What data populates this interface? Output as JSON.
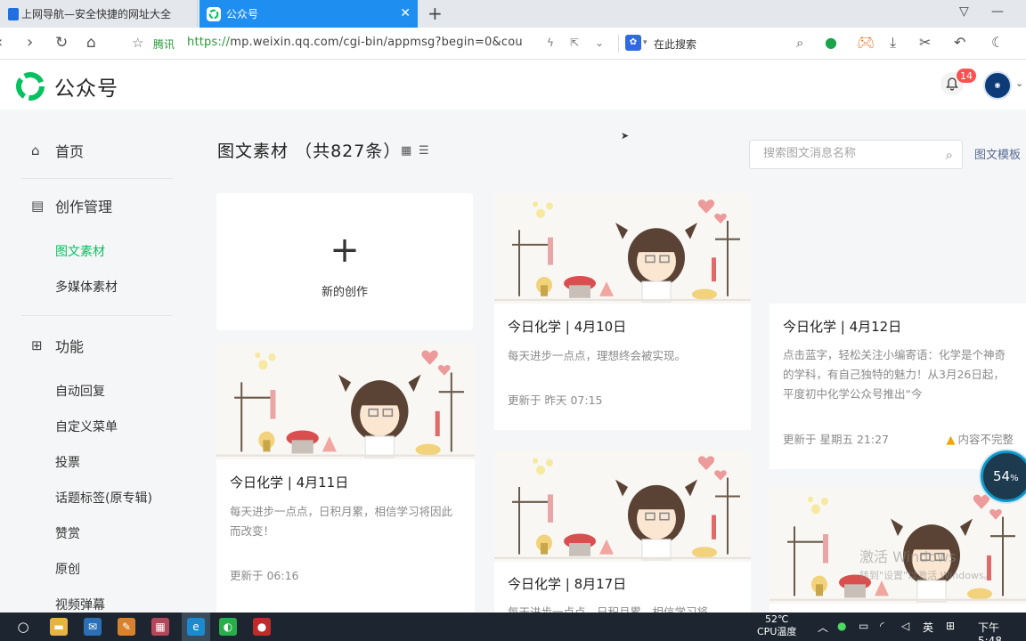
{
  "browser": {
    "tabs": [
      {
        "title": "上网导航—安全快捷的网址大全",
        "active": false
      },
      {
        "title": "公众号",
        "active": true
      }
    ],
    "new_tab": "+",
    "site_label": "腾讯",
    "url_scheme": "https://",
    "url_rest": "mp.weixin.qq.com/cgi-bin/appmsg?begin=0&cou",
    "search_label": "在此搜索"
  },
  "header": {
    "title": "公众号",
    "notification_count": "14",
    "brand_color": "#07c160"
  },
  "sidebar": {
    "home": "首页",
    "creation": "创作管理",
    "creation_items": [
      {
        "label": "图文素材",
        "active": true
      },
      {
        "label": "多媒体素材",
        "active": false
      }
    ],
    "functions": "功能",
    "function_items": [
      "自动回复",
      "自定义菜单",
      "投票",
      "话题标签(原专辑)",
      "赞赏",
      "原创",
      "视频弹幕"
    ]
  },
  "main": {
    "title": "图文素材",
    "count": "（共827条）",
    "search_placeholder": "搜索图文消息名称",
    "template_link": "图文模板",
    "new_creation": "新的创作",
    "cards": [
      {
        "title": "今日化学 | 4月11日",
        "desc": "每天进步一点点，日积月累，相信学习将因此而改变！",
        "time": "更新于 06:16"
      },
      {
        "title": "今日化学 | 4月10日",
        "desc": "每天进步一点点，理想终会被实现。",
        "time": "更新于 昨天 07:15"
      },
      {
        "title": "今日化学 | 8月17日",
        "desc": "每天进步一点点，日积月累，相信学习将",
        "time": ""
      },
      {
        "title": "今日化学 | 4月12日",
        "desc": "点击蓝字，轻松关注小编寄语：化学是个神奇的学科，有自己独特的魅力！从3月26日起，平度初中化学公众号推出“今",
        "time": "更新于 星期五 21:27",
        "warning": "内容不完整"
      }
    ]
  },
  "overlay": {
    "progress_value": "54",
    "progress_unit": "%",
    "watermark_line1": "激活 Windows",
    "watermark_line2": "转到\"设置\"以激活 Windows。"
  },
  "taskbar": {
    "temp_value": "52℃",
    "temp_label": "CPU温度",
    "ime": "英",
    "clock": "下午 5:48"
  }
}
